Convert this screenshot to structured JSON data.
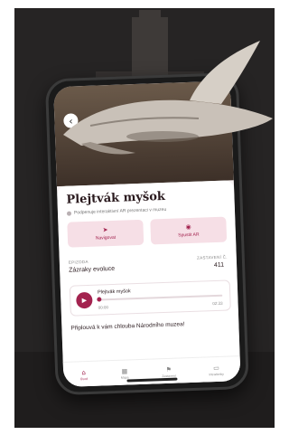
{
  "screen": {
    "title": "Plejtvák myšok",
    "subtitle": "Podpenuje interaktivní AR prezentaci v muzeu",
    "actions": [
      {
        "label": "Navigovat",
        "icon": "navigate-icon"
      },
      {
        "label": "Spustit AR",
        "icon": "ar-icon"
      }
    ],
    "episode_label": "EPIZODA",
    "episode_value": "Zázraky evoluce",
    "stop_label": "ZASTAVENÍ Č.",
    "stop_value": "411",
    "player": {
      "title": "Plejtvák myšok",
      "elapsed": "00:00",
      "duration": "02:33",
      "progress": 0.0
    },
    "description": "Připlouvá k vám chlouba Národního muzea!",
    "nav": [
      {
        "label": "Úvod",
        "icon": "home-icon",
        "active": true
      },
      {
        "label": "Mapa",
        "icon": "map-icon",
        "active": false
      },
      {
        "label": "Zastavení",
        "icon": "stops-icon",
        "active": false
      },
      {
        "label": "Intradenky",
        "icon": "tickets-icon",
        "active": false
      }
    ]
  },
  "colors": {
    "accent": "#a3234f",
    "accent_soft": "#f6dfe6",
    "background": "#2a2a2a"
  }
}
